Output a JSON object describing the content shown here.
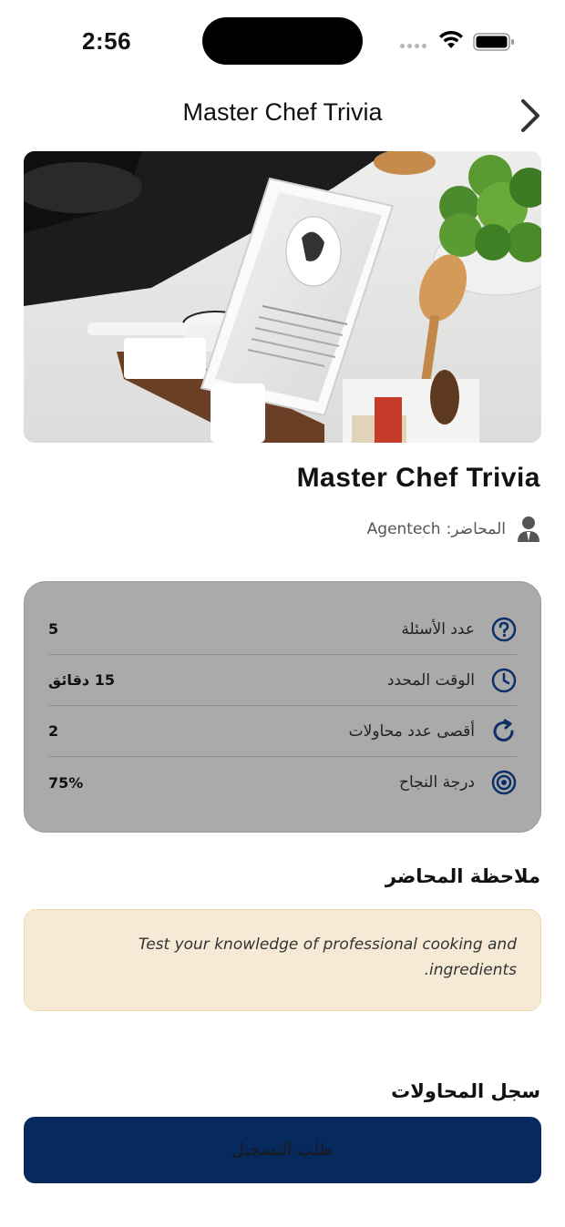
{
  "status_bar": {
    "time": "2:56"
  },
  "nav": {
    "title": "Master Chef Trivia"
  },
  "course": {
    "title": "Master Chef Trivia",
    "instructor_label": "المحاضر:",
    "instructor_name": "Agentech"
  },
  "info": {
    "rows": [
      {
        "icon": "question-circle-icon",
        "label": "عدد الأسئلة",
        "value": "5"
      },
      {
        "icon": "clock-icon",
        "label": "الوقت المحدد",
        "value": "15 دقائق"
      },
      {
        "icon": "refresh-icon",
        "label": "أقصى عدد محاولات",
        "value": "2"
      },
      {
        "icon": "target-icon",
        "label": "درجة النجاح",
        "value": "75%"
      }
    ]
  },
  "note": {
    "heading": "ملاحظة المحاضر",
    "text": "Test your knowledge of professional cooking and ingredients."
  },
  "attempts": {
    "heading": "سجل المحاولات"
  },
  "register": {
    "label": "طلب التسجيل"
  },
  "colors": {
    "accent": "#062a5e",
    "card_bg": "#aaaaaa",
    "note_bg": "#f6ead6",
    "icon_blue": "#0b2f66"
  }
}
